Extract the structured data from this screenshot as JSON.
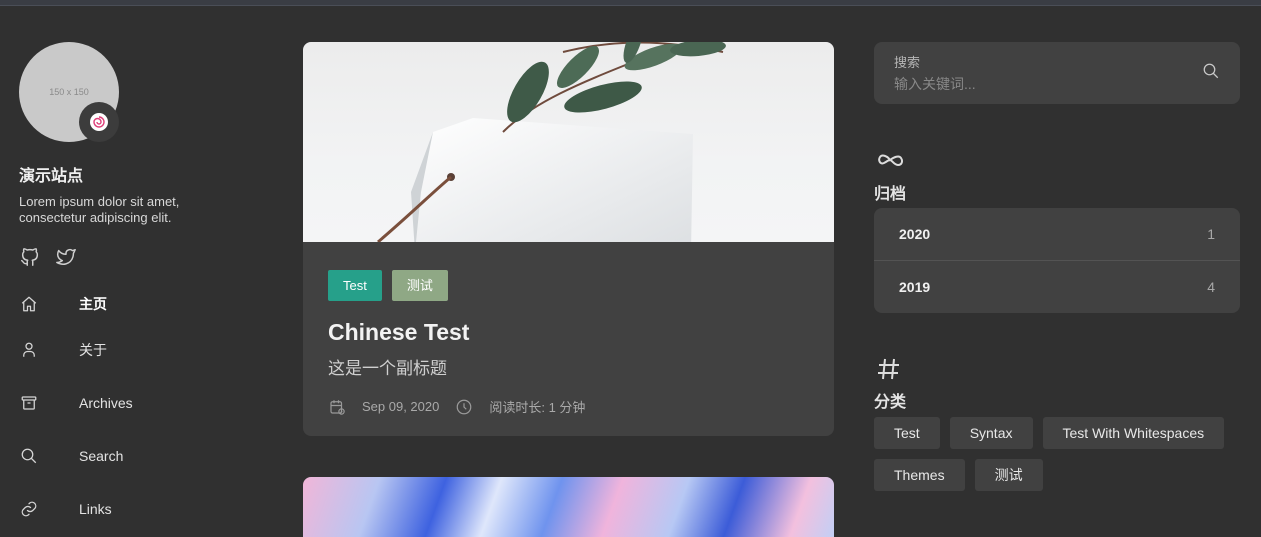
{
  "profile": {
    "avatar_placeholder": "150 x 150",
    "site_name": "演示站点",
    "description": "Lorem ipsum dolor sit amet, consectetur adipiscing elit."
  },
  "social": [
    {
      "icon": "github-icon"
    },
    {
      "icon": "twitter-icon"
    }
  ],
  "nav": [
    {
      "label": "主页",
      "icon": "home-icon",
      "active": true
    },
    {
      "label": "关于",
      "icon": "user-icon"
    },
    {
      "label": "Archives",
      "icon": "archive-icon"
    },
    {
      "label": "Search",
      "icon": "search-icon"
    },
    {
      "label": "Links",
      "icon": "link-icon"
    }
  ],
  "post": {
    "tags": [
      "Test",
      "测试"
    ],
    "title": "Chinese Test",
    "subtitle": "这是一个副标题",
    "date": "Sep 09, 2020",
    "reading_time": "阅读时长: 1 分钟"
  },
  "search": {
    "label": "搜索",
    "placeholder": "输入关键词..."
  },
  "archives": {
    "title": "归档",
    "items": [
      {
        "year": "2020",
        "count": "1"
      },
      {
        "year": "2019",
        "count": "4"
      }
    ]
  },
  "categories": {
    "title": "分类",
    "items": [
      "Test",
      "Syntax",
      "Test With Whitespaces",
      "Themes",
      "测试"
    ]
  },
  "colors": {
    "background": "#303030",
    "card": "#414141",
    "tag_test": "#26a08a",
    "tag_cn": "#8fa885"
  }
}
